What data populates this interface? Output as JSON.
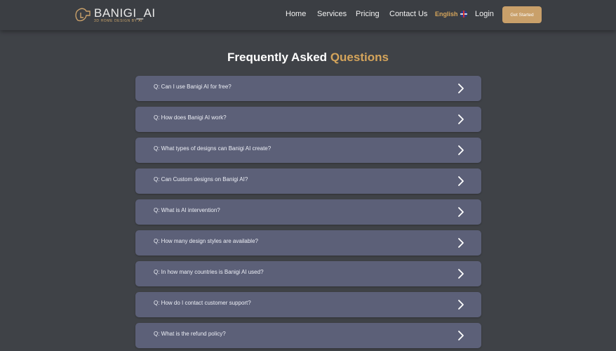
{
  "brand": {
    "name": "BANIGI_AI",
    "tagline": "3D HOME DESIGN BY AI",
    "accent_color": "#c9a06a"
  },
  "nav": {
    "links": [
      "Home",
      "Services",
      "Pricing",
      "Contact Us"
    ],
    "language": "English",
    "login": "Login",
    "cta": "Get Started"
  },
  "faq": {
    "title_main": "Frequently Asked",
    "title_accent": "Questions",
    "items": [
      "Q: Can I use Banigi AI for free?",
      "Q: How does Banigi AI work?",
      "Q: What types of designs can Banigi AI create?",
      "Q: Can Custom designs on Banigi AI?",
      "Q: What is AI intervention?",
      "Q: How many design styles are available?",
      "Q: In how many countries is Banigi AI used?",
      "Q: How do I contact customer support?",
      "Q: What is the refund policy?"
    ]
  }
}
